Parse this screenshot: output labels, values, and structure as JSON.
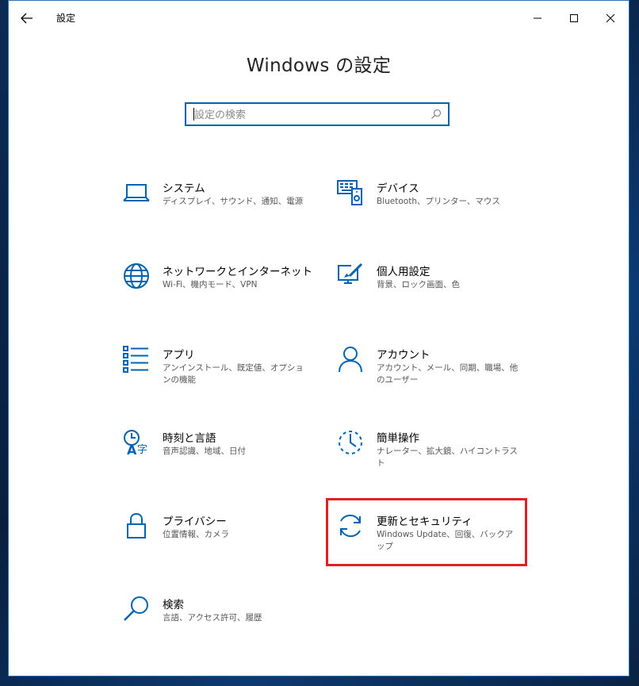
{
  "window": {
    "title": "設定",
    "controls": {
      "minimize_icon": "minimize-icon",
      "maximize_icon": "maximize-icon",
      "close_icon": "close-icon"
    }
  },
  "main": {
    "heading": "Windows の設定",
    "search": {
      "placeholder": "設定の検索",
      "value": ""
    }
  },
  "tiles": [
    {
      "id": "system",
      "name": "システム",
      "desc": "ディスプレイ、サウンド、通知、電源",
      "icon": "laptop-icon"
    },
    {
      "id": "devices",
      "name": "デバイス",
      "desc": "Bluetooth、プリンター、マウス",
      "icon": "devices-icon"
    },
    {
      "id": "network",
      "name": "ネットワークとインターネット",
      "desc": "Wi-Fi、機内モード、VPN",
      "icon": "globe-icon"
    },
    {
      "id": "personalization",
      "name": "個人用設定",
      "desc": "背景、ロック画面、色",
      "icon": "personalization-icon"
    },
    {
      "id": "apps",
      "name": "アプリ",
      "desc": "アンインストール、既定値、オプションの機能",
      "icon": "apps-list-icon"
    },
    {
      "id": "accounts",
      "name": "アカウント",
      "desc": "アカウント、メール、同期、職場、他のユーザー",
      "icon": "person-icon"
    },
    {
      "id": "time-language",
      "name": "時刻と言語",
      "desc": "音声認識、地域、日付",
      "icon": "time-language-icon"
    },
    {
      "id": "ease-of-access",
      "name": "簡単操作",
      "desc": "ナレーター、拡大鏡、ハイコントラスト",
      "icon": "ease-of-access-icon"
    },
    {
      "id": "privacy",
      "name": "プライバシー",
      "desc": "位置情報、カメラ",
      "icon": "lock-icon"
    },
    {
      "id": "update-security",
      "name": "更新とセキュリティ",
      "desc": "Windows Update、回復、バックアップ",
      "icon": "sync-icon"
    },
    {
      "id": "search",
      "name": "検索",
      "desc": "言語、アクセス許可、履歴",
      "icon": "magnifier-icon"
    }
  ],
  "colors": {
    "accent": "#0063b1",
    "highlight": "#e31e24"
  }
}
